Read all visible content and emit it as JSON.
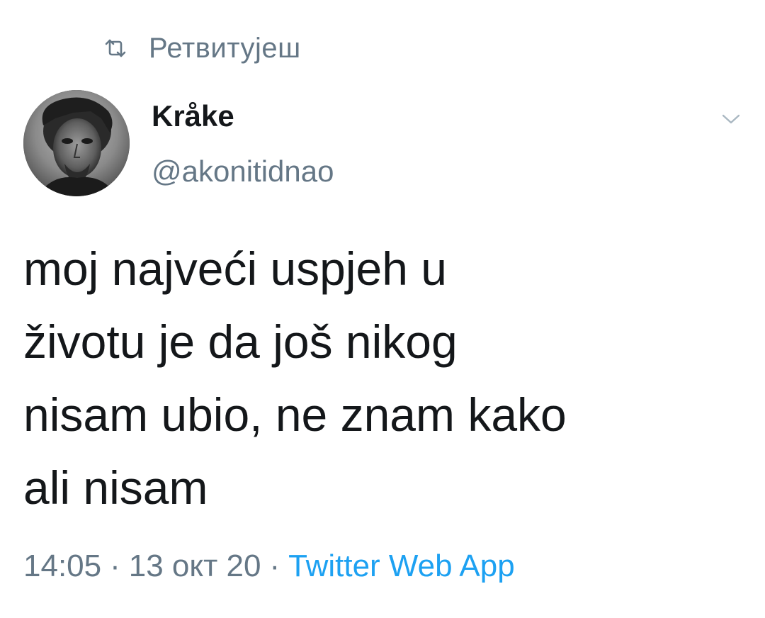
{
  "retweet": {
    "icon": "retweet-icon",
    "label": "Ретвитујеш"
  },
  "author": {
    "display_name": "Kråke",
    "handle": "@akonitidnao",
    "avatar_icon": "avatar-photo"
  },
  "menu": {
    "icon": "chevron-down-icon"
  },
  "tweet": {
    "lines": [
      "moj najveći uspjeh u",
      "životu je da još nikog",
      "nisam ubio, ne znam kako",
      "ali nisam"
    ]
  },
  "meta": {
    "time": "14:05",
    "separator": "·",
    "date": "13 окт 20",
    "source": "Twitter Web App"
  },
  "colors": {
    "text": "#14171a",
    "muted": "#657786",
    "link": "#1da1f2",
    "background": "#ffffff"
  }
}
